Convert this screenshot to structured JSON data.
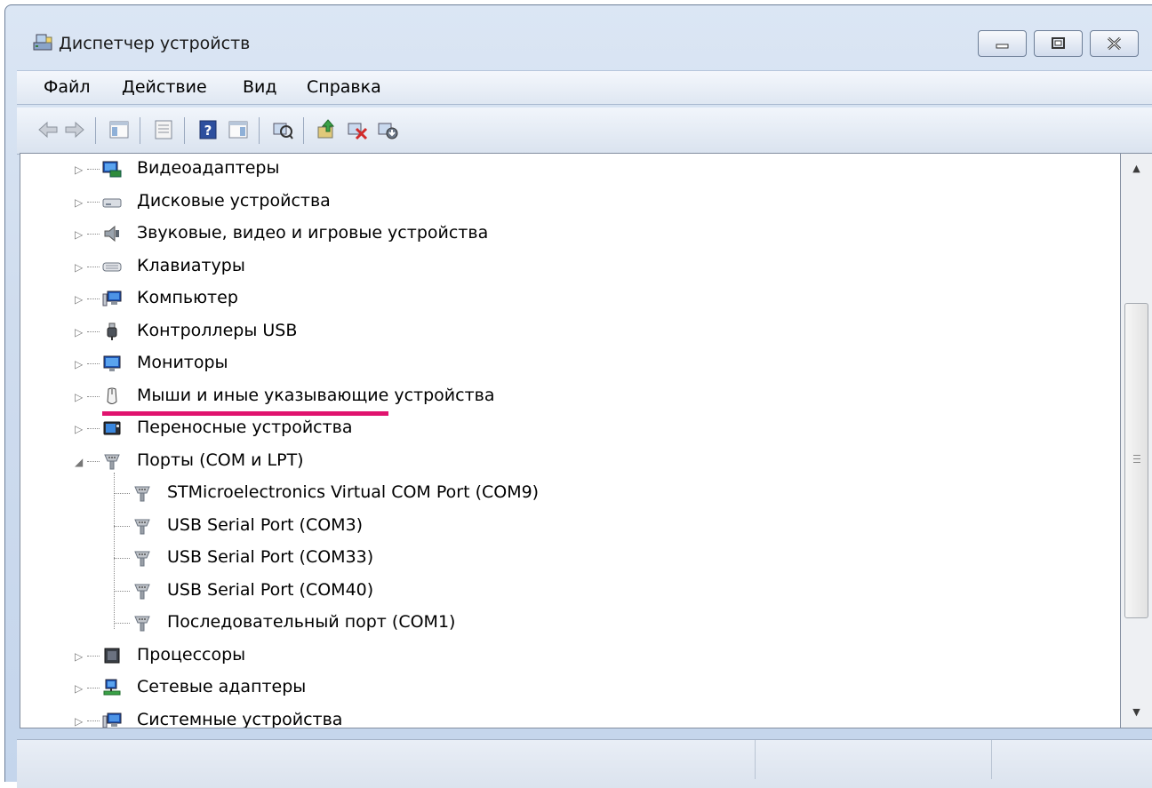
{
  "window": {
    "title": "Диспетчер устройств",
    "icon": "device-manager-icon",
    "controls": [
      "minimize-icon",
      "maximize-icon",
      "close-icon"
    ]
  },
  "menu": {
    "file": "Файл",
    "action": "Действие",
    "view": "Вид",
    "help": "Справка"
  },
  "toolbar": {
    "buttons": [
      "back-icon",
      "forward-icon",
      "show-hide-console-tree-icon",
      "properties-icon",
      "help-icon",
      "show-action-pane-icon",
      "scan-hardware-icon",
      "update-driver-icon",
      "uninstall-icon",
      "disable-icon"
    ]
  },
  "tree": {
    "categories": [
      {
        "label": "Видеоадаптеры",
        "icon": "display-adapter-icon",
        "expanded": false
      },
      {
        "label": "Дисковые устройства",
        "icon": "disk-drive-icon",
        "expanded": false
      },
      {
        "label": "Звуковые, видео и игровые устройства",
        "icon": "speaker-icon",
        "expanded": false
      },
      {
        "label": "Клавиатуры",
        "icon": "keyboard-icon",
        "expanded": false
      },
      {
        "label": "Компьютер",
        "icon": "computer-icon",
        "expanded": false
      },
      {
        "label": "Контроллеры USB",
        "icon": "usb-plug-icon",
        "expanded": false
      },
      {
        "label": "Мониторы",
        "icon": "monitor-icon",
        "expanded": false
      },
      {
        "label": "Мыши и иные указывающие устройства",
        "icon": "mouse-icon",
        "expanded": false
      },
      {
        "label": "Переносные устройства",
        "icon": "portable-device-icon",
        "expanded": false
      },
      {
        "label": "Порты (COM и LPT)",
        "icon": "port-icon",
        "expanded": true
      },
      {
        "label": "Процессоры",
        "icon": "processor-icon",
        "expanded": false
      },
      {
        "label": "Сетевые адаптеры",
        "icon": "network-adapter-icon",
        "expanded": false
      },
      {
        "label": "Системные устройства",
        "icon": "system-device-icon",
        "expanded": false
      }
    ],
    "ports": [
      {
        "label": "STMicroelectronics Virtual COM Port (COM9)",
        "icon": "port-icon"
      },
      {
        "label": "USB Serial Port (COM3)",
        "icon": "port-icon"
      },
      {
        "label": "USB Serial Port (COM33)",
        "icon": "port-icon",
        "highlighted": true
      },
      {
        "label": "USB Serial Port (COM40)",
        "icon": "port-icon"
      },
      {
        "label": "Последовательный порт (COM1)",
        "icon": "port-icon"
      }
    ]
  },
  "colors": {
    "highlight": "#e0136e",
    "window_frame": "#cfdcee"
  }
}
